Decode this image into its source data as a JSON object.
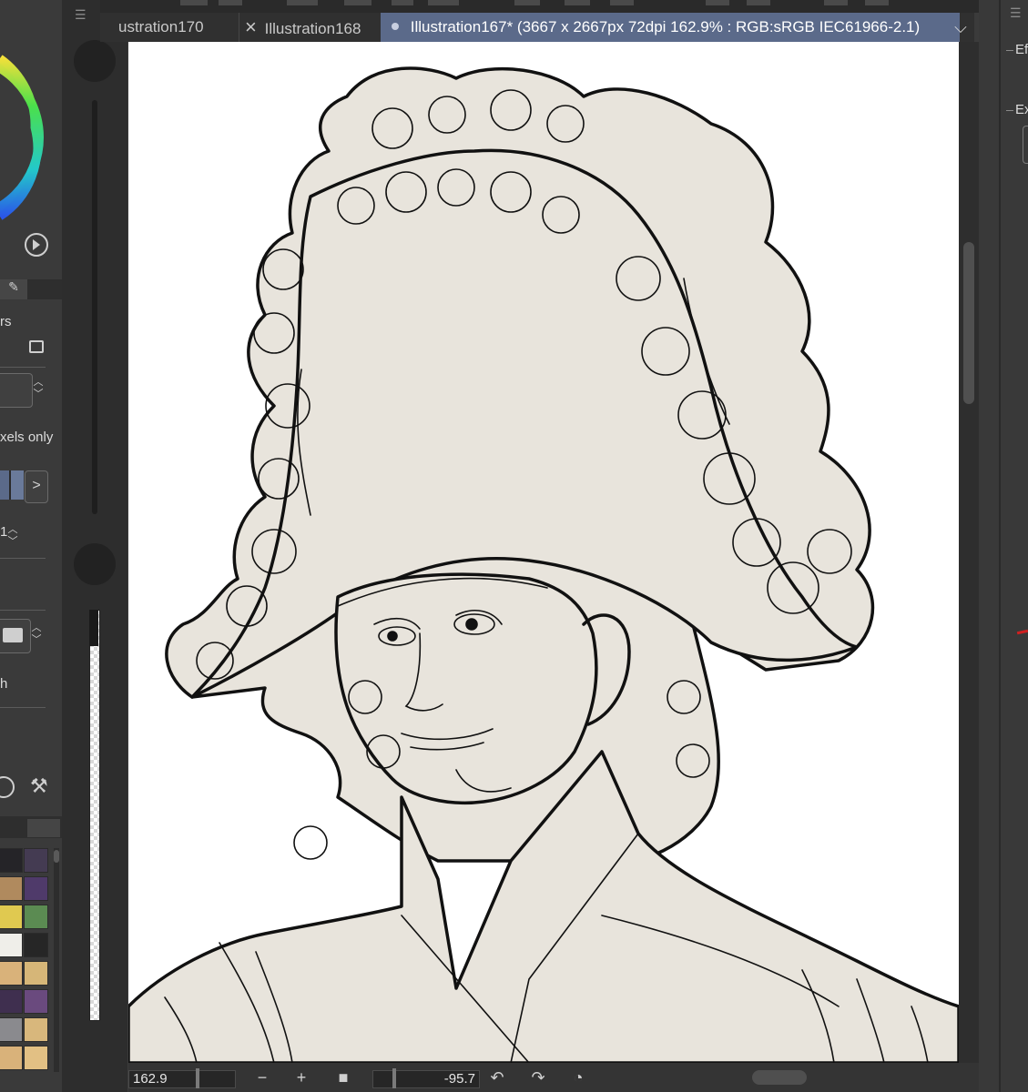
{
  "tabs": [
    {
      "label": "ustration170",
      "active": false
    },
    {
      "label": "Illustration168",
      "active": false,
      "close": "×"
    },
    {
      "label": "Illustration167* (3667 x 2667px 72dpi 162.9% : RGB:sRGB IEC61966-2.1)",
      "active": true
    }
  ],
  "left_panel": {
    "layers_label": "rs",
    "pixels_only_label": "xels only",
    "stepper_value": "1",
    "blend_label": "h"
  },
  "right_panel": {
    "effect_label": "Ef",
    "expression_label": "Ex"
  },
  "status": {
    "zoom": "162.9",
    "rotation": "-95.7"
  },
  "swatches": [
    [
      "#252428",
      "#443b52"
    ],
    [
      "#b08a5e",
      "#4f3a6a"
    ],
    [
      "#e0c950",
      "#5b8b52"
    ],
    [
      "#efeee9",
      "#262626"
    ],
    [
      "#d9b27a",
      "#d6b678"
    ],
    [
      "#3f2f4f",
      "#6a4a7e"
    ],
    [
      "#8a8a8e",
      "#d8b77c"
    ],
    [
      "#d9b27a",
      "#e2c084"
    ]
  ],
  "colors": {
    "accent_tab": "#5b6a8a",
    "canvas_fill": "#e8e4dc",
    "line": "#111111"
  },
  "icons": [
    "menu-icon",
    "close-icon",
    "chevron-down-icon",
    "play-icon",
    "lock-icon",
    "layer-mode-icon",
    "folder-icon",
    "chevron-right-icon",
    "clock-icon",
    "wrench-icon",
    "zoom-out-icon",
    "zoom-in-icon",
    "reset-icon",
    "rotate-left-icon",
    "rotate-right-icon",
    "rotate-reset-icon"
  ]
}
